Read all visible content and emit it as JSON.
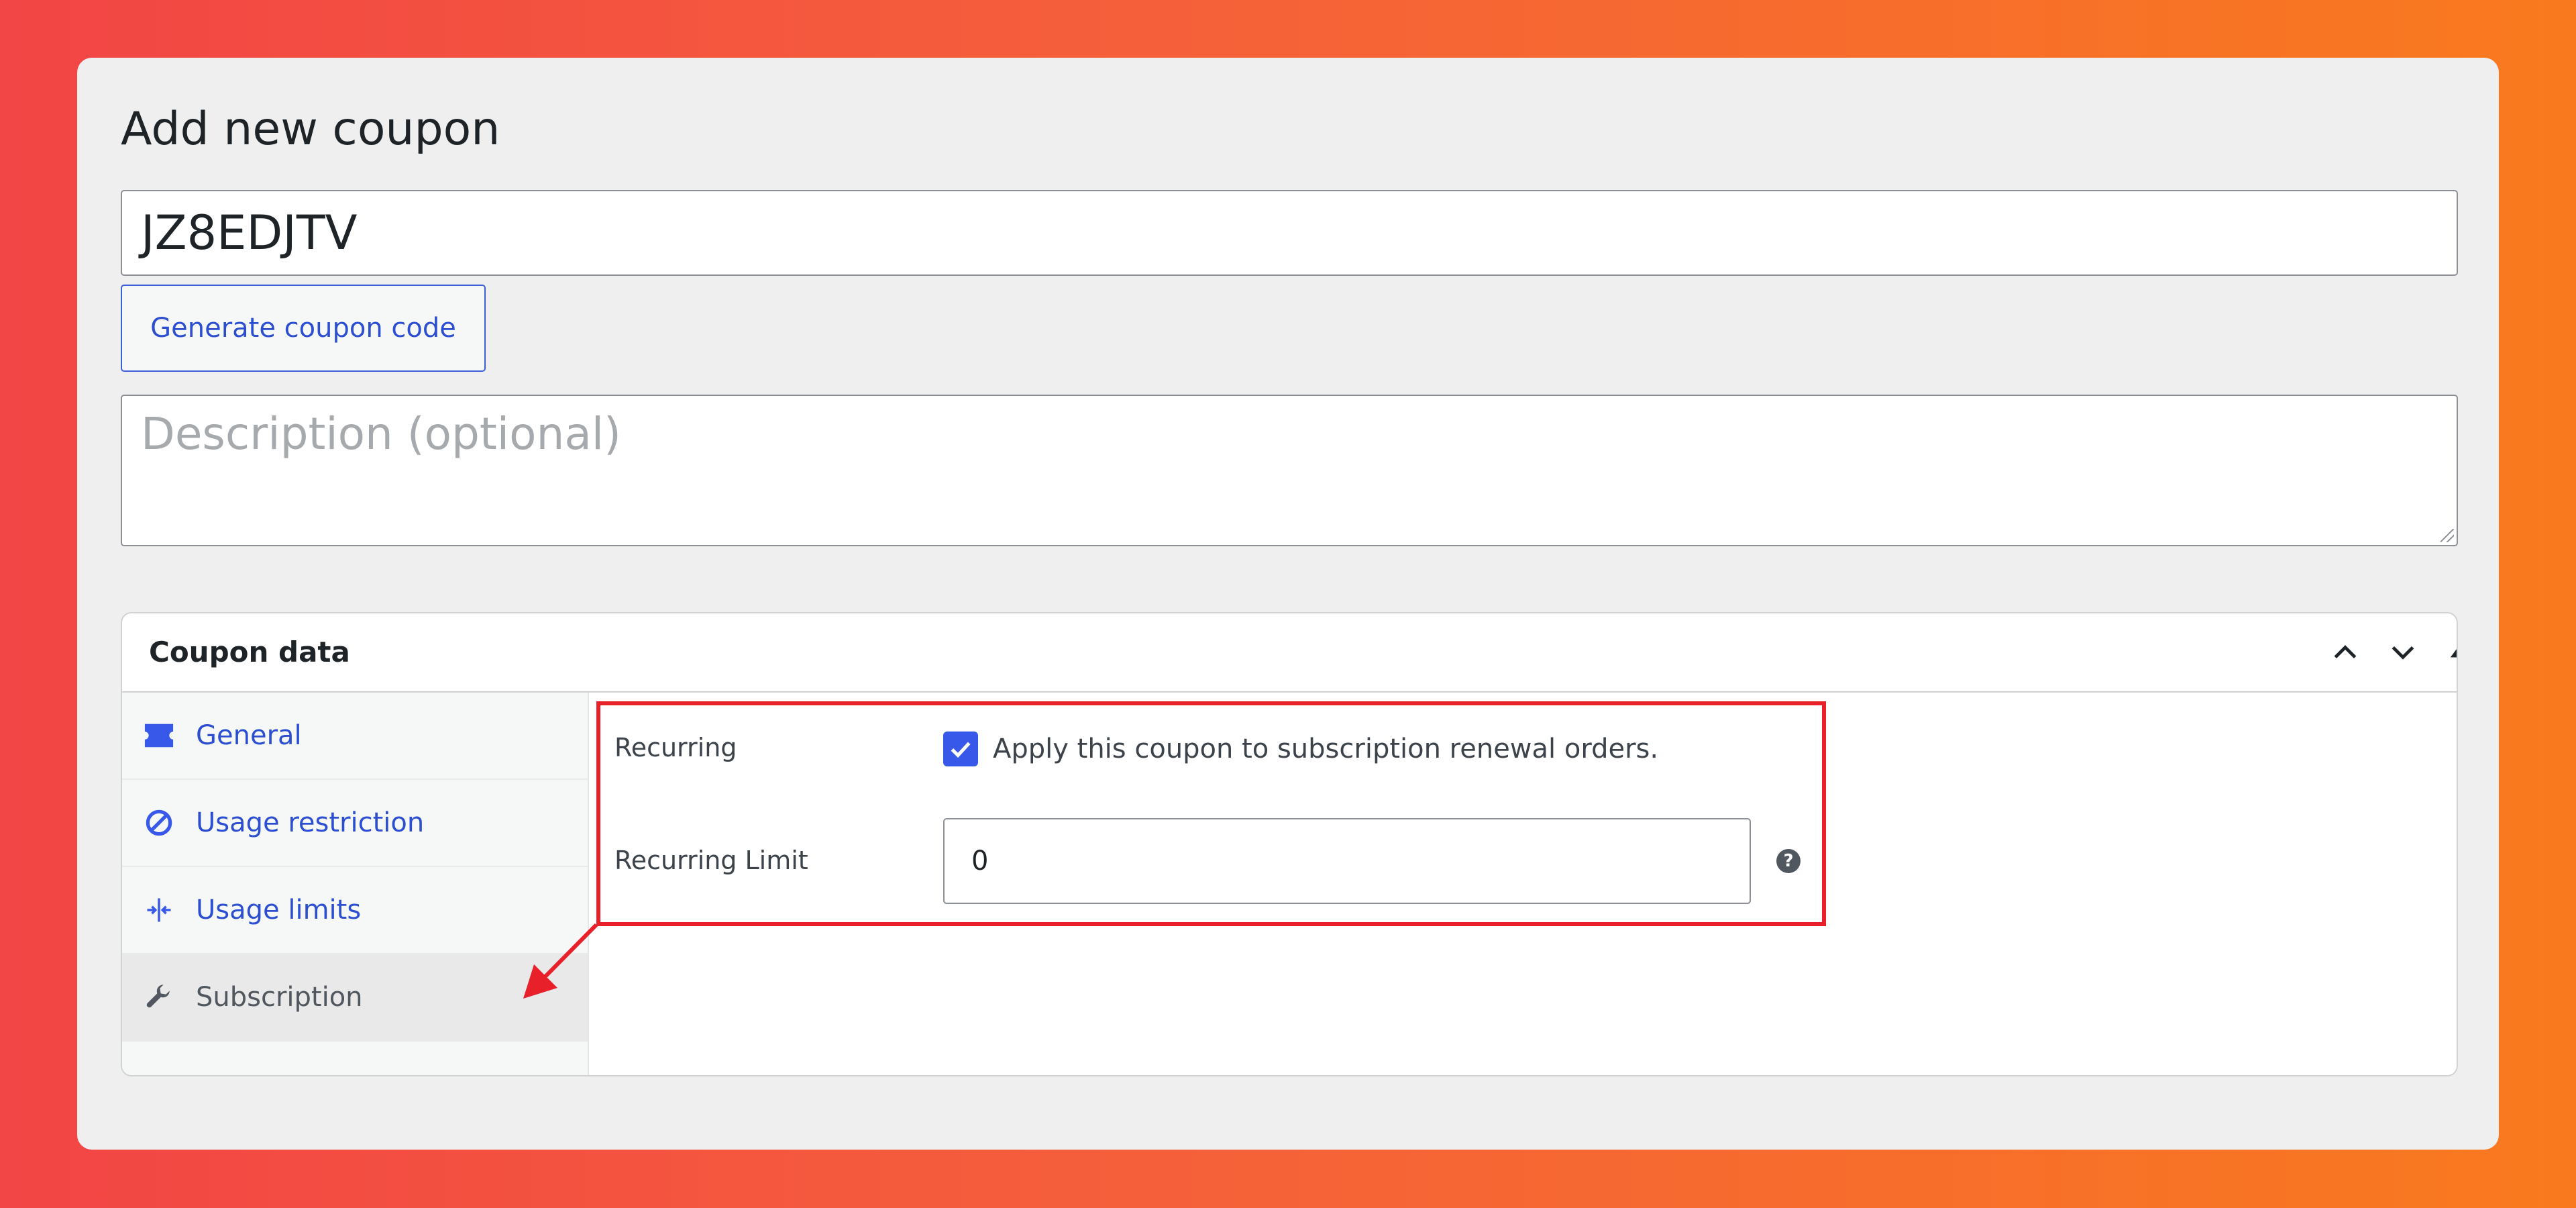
{
  "page": {
    "title": "Add new coupon"
  },
  "coupon": {
    "code_value": "JZ8EDJTV",
    "generate_label": "Generate coupon code",
    "description_placeholder": "Description (optional)"
  },
  "coupon_data": {
    "title": "Coupon data",
    "tabs": [
      {
        "label": "General",
        "icon": "ticket-icon",
        "active": false
      },
      {
        "label": "Usage restriction",
        "icon": "block-icon",
        "active": false
      },
      {
        "label": "Usage limits",
        "icon": "limits-icon",
        "active": false
      },
      {
        "label": "Subscription",
        "icon": "wrench-icon",
        "active": true
      }
    ],
    "recurring": {
      "label": "Recurring",
      "checked": true,
      "checkbox_text": "Apply this coupon to subscription renewal orders."
    },
    "recurring_limit": {
      "label": "Recurring Limit",
      "value": "0"
    }
  },
  "colors": {
    "accent": "#3858e9",
    "link": "#2c4fd1",
    "annotation": "#e8202a"
  }
}
